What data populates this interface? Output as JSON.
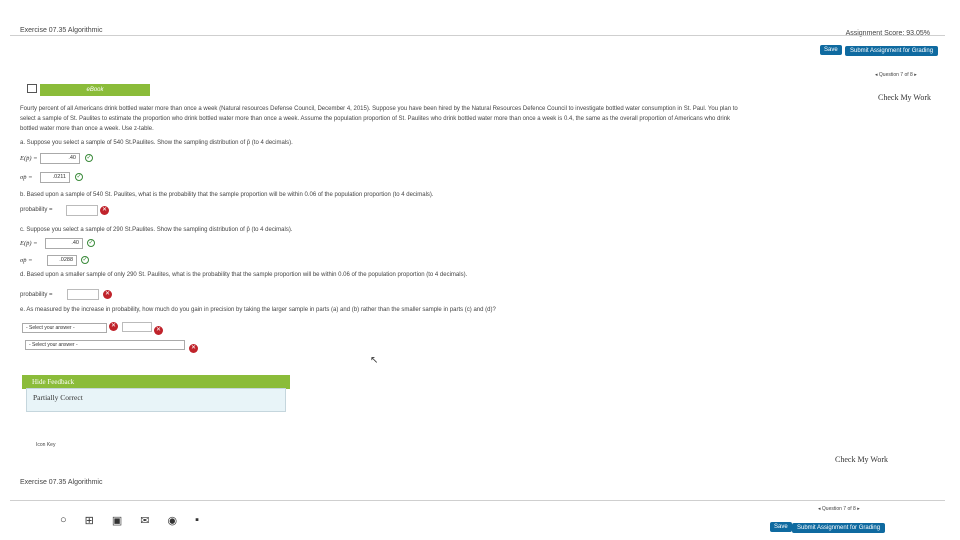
{
  "header": {
    "exercise_title": "Exercise 07.35 Algorithmic",
    "assignment_score": "Assignment Score: 93.05%",
    "save_label": "Save",
    "submit_label": "Submit Assignment for Grading",
    "question_nav": "◂ Question 7 of 8 ▸"
  },
  "ebook": {
    "label": "eBook",
    "check_my_work": "Check My Work"
  },
  "problem": {
    "intro1": "Fourty percent of all Americans drink bottled water more than once a week (Natural resources Defense Council, December 4, 2015). Suppose you have been hired by the Natural Resources Defence Council to investigate bottled water consumption in St. Paul. You plan to",
    "intro2": "select a sample of St. Paulites to estimate the proportion who drink bottled water more than once a week. Assume the population proportion of St. Paulites who drink bottled water more than once a week is 0.4, the same as the overall proportion of Americans who drink",
    "intro3": "bottled water more than once a week. Use z-table.",
    "part_a": "a. Suppose you select a sample of 540 St.Paulites. Show the sampling distribution of p̄ (to 4 decimals).",
    "part_a_ep_label": "E(p̄) =",
    "part_a_ep_value": ".40",
    "part_a_sd_label": "σp̄ =",
    "part_a_sd_value": ".0211",
    "part_b": "b. Based upon a sample of 540 St. Paulites, what is the probability that the sample proportion will be within 0.06 of the population proportion (to 4 decimals).",
    "part_b_prob_label": "probability =",
    "part_c": "c. Suppose you select a sample of 290 St.Paulites. Show the sampling distribution of p̄ (to 4 decimals).",
    "part_c_ep_label": "E(p̄) =",
    "part_c_ep_value": ".40",
    "part_c_sd_label": "σp̄ =",
    "part_c_sd_value": ".0288",
    "part_d": "d. Based upon a smaller sample of only 290 St. Paulites, what is the probability that the sample proportion will be within 0.06 of the population proportion (to 4 decimals).",
    "part_d_prob_label": "probability =",
    "part_e": "e. As measured by the increase in probability, how much do you gain in precision by taking the larger sample in parts (a) and (b) rather than the smaller sample in parts (c) and (d)?",
    "select1": "- Select your answer -",
    "select2": "- Select your answer -"
  },
  "feedback": {
    "toggle_label": "Hide Feedback",
    "status": "Partially Correct"
  },
  "footer": {
    "icon_key_label": "Icon Key",
    "check_my_work": "Check My Work",
    "exercise_title": "Exercise 07.35 Algorithmic",
    "question_nav": "◂ Question 7 of 8 ▸",
    "save_label": "Save",
    "submit_label": "Submit Assignment for Grading"
  },
  "colors": {
    "accent_green": "#8bbc3a",
    "button_blue": "#0f6aa0",
    "error_red": "#c0232b",
    "ok_green": "#3a8a3a"
  }
}
